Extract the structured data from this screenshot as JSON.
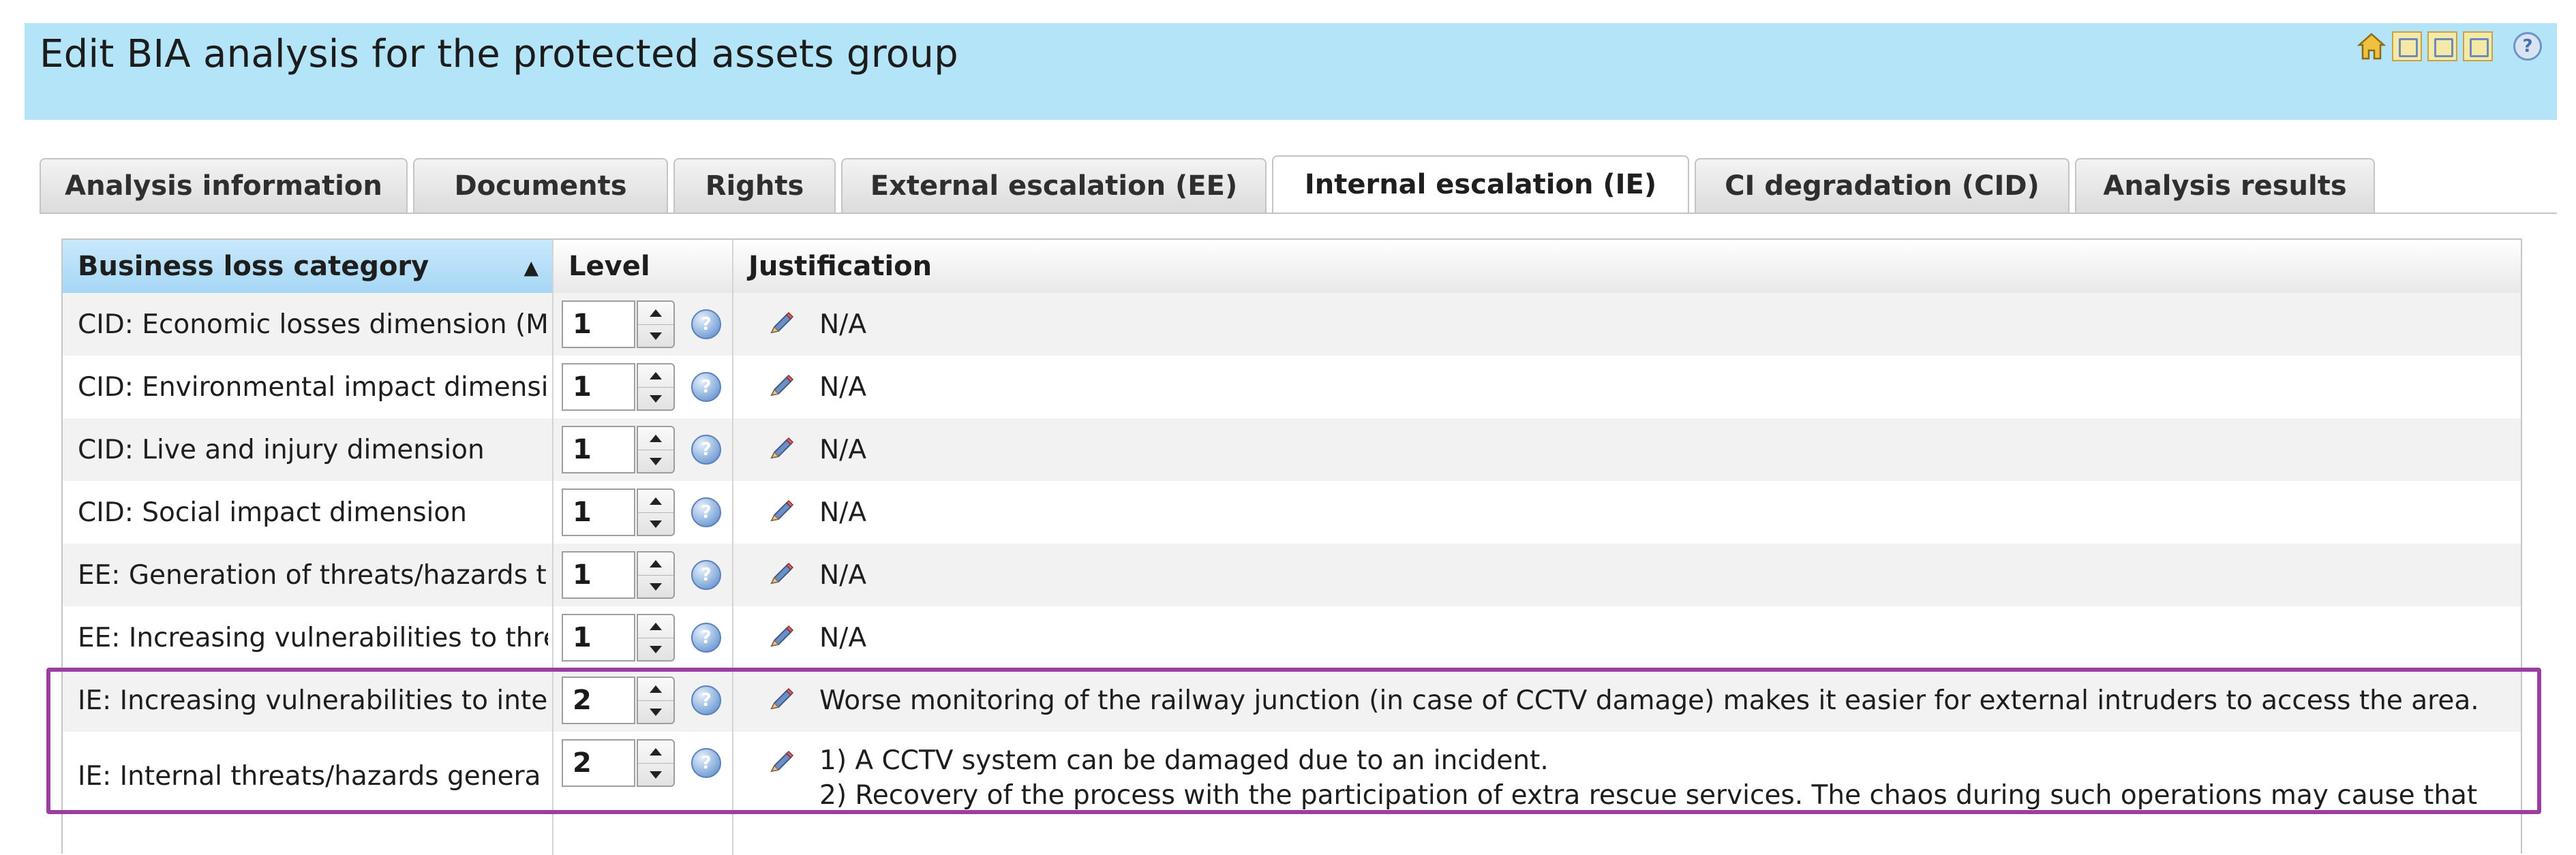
{
  "window": {
    "title": "Edit BIA analysis for the protected assets group"
  },
  "toolbar": {
    "icons": [
      "home-icon",
      "sheet-icon",
      "sheet-icon",
      "sheet-icon",
      "help-icon"
    ],
    "help_glyph": "?"
  },
  "tabs": [
    {
      "label": "Analysis information",
      "active": false
    },
    {
      "label": "Documents",
      "active": false
    },
    {
      "label": "Rights",
      "active": false
    },
    {
      "label": "External escalation (EE)",
      "active": false
    },
    {
      "label": "Internal escalation (IE)",
      "active": true
    },
    {
      "label": "CI degradation (CID)",
      "active": false
    },
    {
      "label": "Analysis results",
      "active": false
    }
  ],
  "grid": {
    "columns": {
      "category": "Business loss category",
      "level": "Level",
      "justification": "Justification"
    },
    "sort_glyph": "▲",
    "help_glyph": "?",
    "rows": [
      {
        "category": "CID: Economic losses dimension (M",
        "level": "1",
        "justification": [
          "N/A"
        ]
      },
      {
        "category": "CID: Environmental impact dimensi",
        "level": "1",
        "justification": [
          "N/A"
        ]
      },
      {
        "category": "CID: Live and injury dimension",
        "level": "1",
        "justification": [
          "N/A"
        ]
      },
      {
        "category": "CID: Social impact dimension",
        "level": "1",
        "justification": [
          "N/A"
        ]
      },
      {
        "category": "EE: Generation of threats/hazards t",
        "level": "1",
        "justification": [
          "N/A"
        ]
      },
      {
        "category": "EE: Increasing vulnerabilities to thre",
        "level": "1",
        "justification": [
          "N/A"
        ]
      },
      {
        "category": "IE: Increasing vulnerabilities to inte",
        "level": "2",
        "justification": [
          "Worse monitoring of the railway junction (in case of CCTV damage)  makes it easier for external intruders to access the area."
        ]
      },
      {
        "category": "IE: Internal threats/hazards genera",
        "level": "2",
        "justification": [
          "1) A CCTV system can be damaged due to an incident.",
          "2) Recovery of the process with the participation of extra rescue services. The chaos during such operations may cause that"
        ]
      }
    ]
  },
  "colors": {
    "title_bar": "#b3e4f8",
    "sorted_header": "#a6d7f5",
    "highlight": "#9b3e9e"
  }
}
